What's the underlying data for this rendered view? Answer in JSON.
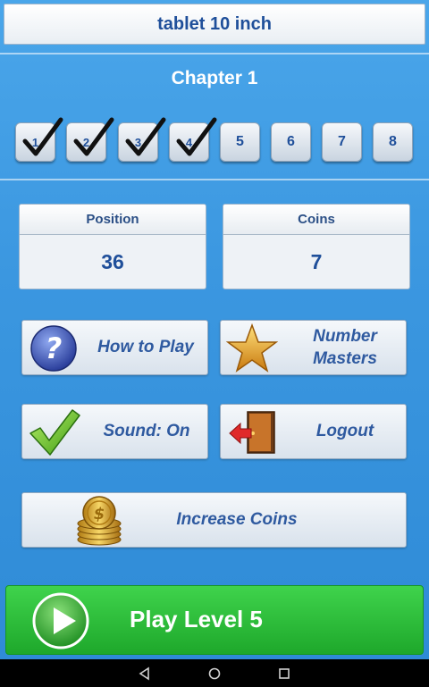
{
  "search": {
    "value": "tablet 10 inch"
  },
  "chapter": {
    "title": "Chapter 1"
  },
  "levels": [
    {
      "label": "1",
      "completed": true
    },
    {
      "label": "2",
      "completed": true
    },
    {
      "label": "3",
      "completed": true
    },
    {
      "label": "4",
      "completed": true
    },
    {
      "label": "5",
      "completed": false
    },
    {
      "label": "6",
      "completed": false
    },
    {
      "label": "7",
      "completed": false
    },
    {
      "label": "8",
      "completed": false
    }
  ],
  "stats": {
    "position": {
      "label": "Position",
      "value": "36"
    },
    "coins": {
      "label": "Coins",
      "value": "7"
    }
  },
  "buttons": {
    "how_to_play": "How to Play",
    "number_masters_line1": "Number",
    "number_masters_line2": "Masters",
    "sound": "Sound: On",
    "logout": "Logout",
    "increase_coins": "Increase Coins",
    "play_level": "Play Level 5"
  },
  "colors": {
    "background": "#3b97e0",
    "button_text": "#2f5aa0",
    "play_green": "#2cc23a"
  },
  "icons": {
    "how_to_play": "question-icon",
    "number_masters": "star-icon",
    "sound": "checkmark-icon",
    "logout": "door-exit-icon",
    "increase_coins": "coin-stack-icon",
    "play": "play-icon"
  }
}
